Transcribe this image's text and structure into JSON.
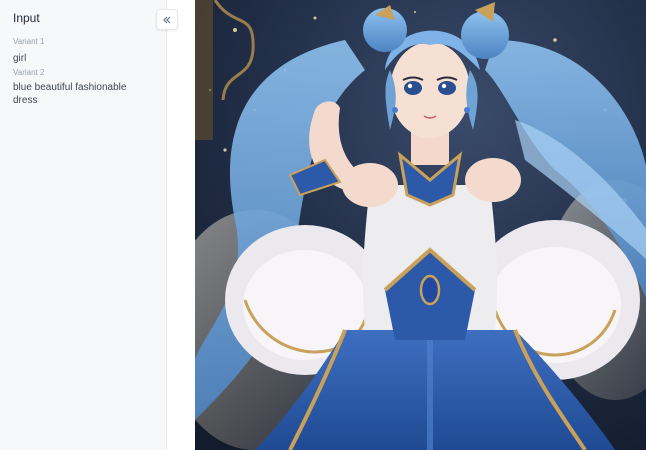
{
  "panel": {
    "title": "Input",
    "variants": [
      {
        "label": "Variant 1",
        "value": "girl"
      },
      {
        "label": "Variant 2",
        "value": "blue beautiful fashionable dress"
      }
    ]
  },
  "icons": {
    "collapse": "chevrons-left-icon"
  },
  "colors": {
    "sidebar_bg": "#f7f8fa",
    "hair_blue": "#6fa3d6",
    "dress_blue": "#2f5fae",
    "gold_trim": "#c9a15a"
  }
}
